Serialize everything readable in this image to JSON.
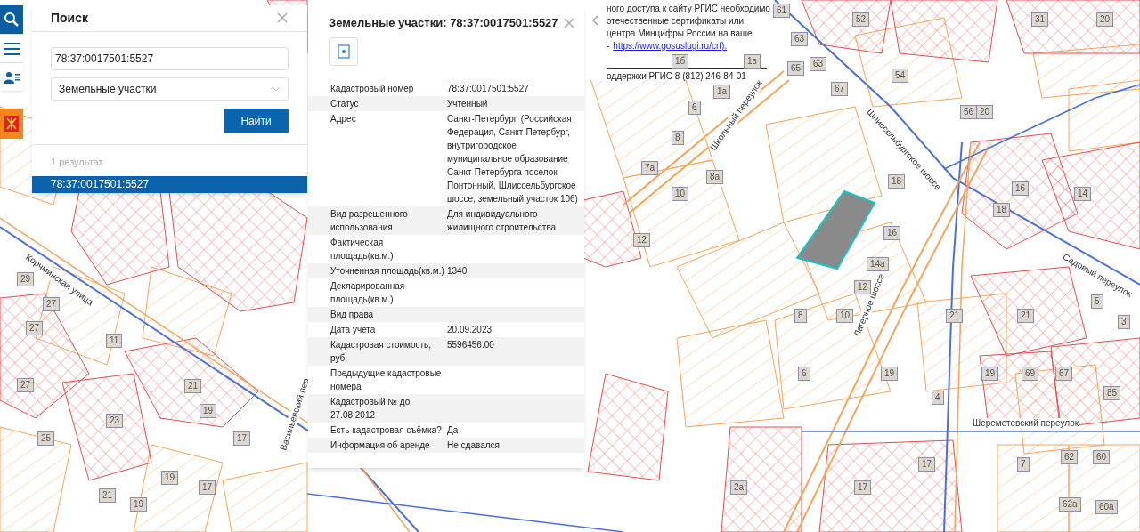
{
  "toolbar": [
    {
      "kind": "search",
      "selected": true
    },
    {
      "kind": "menu",
      "selected": false
    },
    {
      "kind": "contacts",
      "selected": false
    }
  ],
  "notice": {
    "lines": [
      "ного доступа к сайту РГИС необходимо",
      "отечественные сертификаты или",
      "центра Минцифры России на ваше"
    ],
    "link_prefix": "-",
    "link": "https://www.gosuslugi.ru/crt).",
    "support": "оддержки РГИС 8 (812) 246-84-01"
  },
  "search_panel": {
    "title": "Поиск",
    "query": "78:37:0017501:5527",
    "object_type": "Земельные участки",
    "button": "Найти",
    "result_count": "1 результат",
    "results": [
      {
        "label": "78:37:0017501:5527",
        "selected": true
      }
    ]
  },
  "info_panel": {
    "title": "Земельные участки: 78:37:0017501:5527",
    "rows": [
      {
        "label": "Кадастровый номер",
        "value": "78:37:0017501:5527"
      },
      {
        "label": "Статус",
        "value": "Учтенный"
      },
      {
        "label": "Адрес",
        "value": "Санкт-Петербург, (Российская Федерация, Санкт-Петербург, внутригородское муниципальное образование Санкт-Петербурга поселок Понтонный, Шлиссельбургское шоссе, земельный участок 106)"
      },
      {
        "label": "Вид разрешенного использования",
        "value": "Для индивидуального жилищного строительства"
      },
      {
        "label": "Фактическая площадь(кв.м.)"
      },
      {
        "label": "Уточненная площадь(кв.м.)",
        "value": "1340"
      },
      {
        "label": "Декларированная площадь(кв.м.)"
      },
      {
        "label": "Вид права"
      },
      {
        "label": "Дата учета",
        "value": "20.09.2023"
      },
      {
        "label": "Кадастровая стоимость, руб.",
        "value": "5596456.00"
      },
      {
        "label": "Предыдущие кадастровые номера"
      },
      {
        "label": "Кадастровый № до 27.08.2012"
      },
      {
        "label": "Есть кадастровая съёмка?",
        "value": "Да"
      },
      {
        "label": "Информация об аренде",
        "value": "Не сдавался"
      }
    ]
  },
  "map": {
    "streets": [
      "Корчминская улица",
      "Васильевский пер",
      "Школьный переулок",
      "Шлиссельбургское шоссе",
      "Лагерное шоссе",
      "Садовый переулок",
      "Шереметевский переулок"
    ],
    "house_numbers": [
      "61",
      "52",
      "31",
      "20",
      "63",
      "1б",
      "1в",
      "63",
      "65",
      "54",
      "67",
      "1а",
      "6",
      "56",
      "20",
      "8",
      "7а",
      "8а",
      "18",
      "16",
      "10",
      "14",
      "18",
      "16",
      "12",
      "14а",
      "29",
      "12",
      "5",
      "27",
      "8",
      "10",
      "21",
      "21",
      "3",
      "27",
      "11",
      "6",
      "19",
      "19",
      "69",
      "67",
      "27",
      "21",
      "85",
      "4",
      "19",
      "23",
      "25",
      "17",
      "62",
      "60",
      "17",
      "7",
      "19",
      "17",
      "2а",
      "17",
      "21",
      "19",
      "62а",
      "60а"
    ]
  }
}
